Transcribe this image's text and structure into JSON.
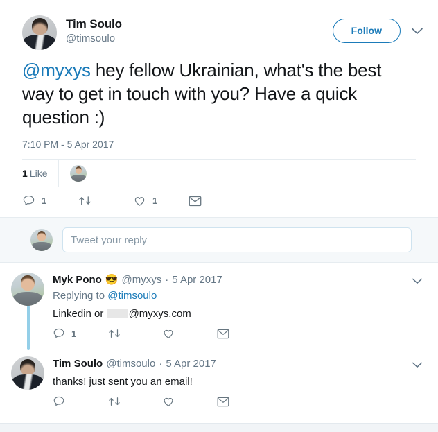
{
  "main_tweet": {
    "author_name": "Tim Soulo",
    "author_handle": "@timsoulo",
    "avatar_alt": "tim-soulo-avatar",
    "follow_label": "Follow",
    "text_mention": "@myxys",
    "text_rest": " hey fellow Ukrainian, what's the best way to get in touch with you? Have a quick question :)",
    "timestamp": "7:10 PM - 5 Apr 2017",
    "likes_count": "1",
    "likes_label": "Like",
    "actions": {
      "reply_count": "1",
      "retweet_count": "",
      "like_count": "1",
      "dm_count": ""
    }
  },
  "composer": {
    "avatar_alt": "my-avatar",
    "placeholder": "Tweet your reply",
    "value": ""
  },
  "replies": [
    {
      "author_name": "Myk Pono",
      "emoji": "😎",
      "handle": "@myxys",
      "separator": "·",
      "date": "5 Apr 2017",
      "replying_prefix": "Replying to ",
      "replying_mention": "@timsoulo",
      "text_before": "Linkedin or ",
      "text_redacted": true,
      "text_after": "@myxys.com",
      "avatar_alt": "myk-pono-avatar",
      "actions": {
        "reply_count": "1",
        "retweet_count": "",
        "like_count": "",
        "dm_count": ""
      }
    },
    {
      "author_name": "Tim Soulo",
      "emoji": "",
      "handle": "@timsoulo",
      "separator": "·",
      "date": "5 Apr 2017",
      "replying_prefix": "",
      "replying_mention": "",
      "text_before": "thanks! just sent you an email!",
      "text_redacted": false,
      "text_after": "",
      "avatar_alt": "tim-soulo-avatar",
      "actions": {
        "reply_count": "",
        "retweet_count": "",
        "like_count": "",
        "dm_count": ""
      }
    }
  ],
  "icons": {
    "reply": "reply-icon",
    "retweet": "retweet-icon",
    "like": "heart-icon",
    "dm": "envelope-icon",
    "caret": "chevron-down-icon"
  },
  "colors": {
    "link": "#1b7bb9",
    "muted": "#657786",
    "text": "#14171a",
    "thread_line": "#94cfe8",
    "composer_bg": "#f5f8fa",
    "divider": "#e6ecf0"
  }
}
